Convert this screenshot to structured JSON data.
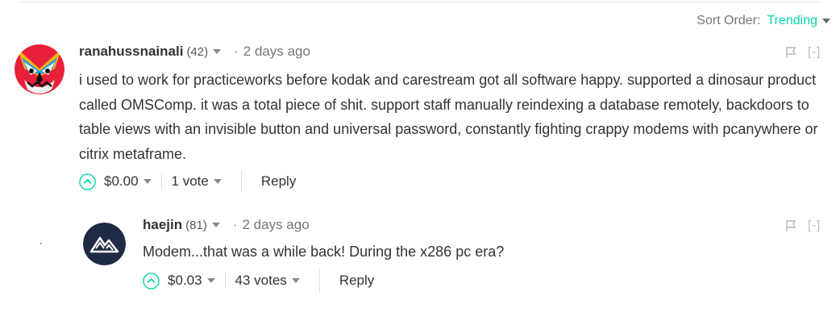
{
  "sort": {
    "label": "Sort Order:",
    "value": "Trending"
  },
  "comments": [
    {
      "author": "ranahussnainali",
      "reputation": "(42)",
      "dot": "·",
      "time": "2 days ago",
      "collapse": "[-]",
      "body": "i used to work for practiceworks before kodak and carestream got all software happy. supported a dinosaur product called OMSComp. it was a total piece of shit. support staff manually reindexing a database remotely, backdoors to table views with an invisible button and universal password, constantly fighting crappy modems with pcanywhere or citrix metaframe.",
      "payout": "$0.00",
      "votes": "1 vote",
      "reply": "Reply"
    },
    {
      "author": "haejin",
      "reputation": "(81)",
      "dot": "·",
      "time": "2 days ago",
      "collapse": "[-]",
      "body": "Modem...that was a while back! During the x286 pc era?",
      "payout": "$0.03",
      "votes": "43 votes",
      "reply": "Reply"
    }
  ],
  "colors": {
    "accent": "#06d6a9",
    "avatar2_bg": "#1f2a44"
  }
}
